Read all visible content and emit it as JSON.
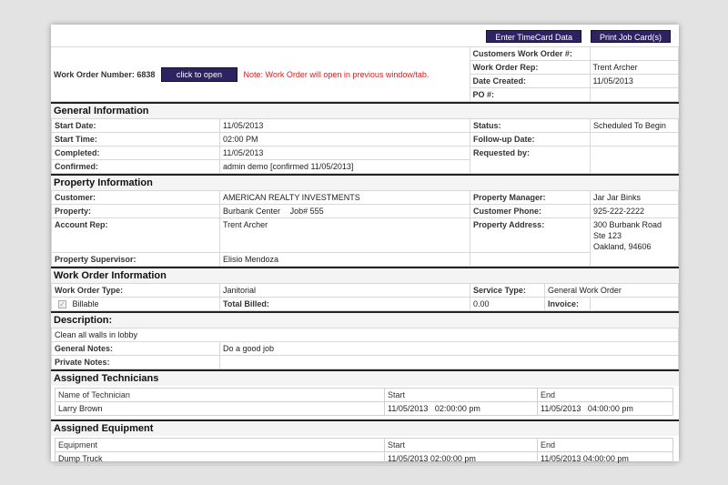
{
  "toolbar": {
    "timecard_label": "Enter TimeCard Data",
    "print_label": "Print Job Card(s)"
  },
  "work_order": {
    "number_label": "Work Order Number:",
    "number": "6838",
    "open_label": "click to open",
    "note": "Note: Work Order will open in previous window/tab.",
    "customers_wo_label": "Customers Work Order #:",
    "customers_wo_value": "",
    "rep_label": "Work Order Rep:",
    "rep_value": "Trent Archer",
    "created_label": "Date Created:",
    "created_value": "11/05/2013",
    "po_label": "PO #:",
    "po_value": ""
  },
  "general": {
    "title": "General Information",
    "start_date_label": "Start Date:",
    "start_date": "11/05/2013",
    "start_time_label": "Start Time:",
    "start_time": "02:00 PM",
    "completed_label": "Completed:",
    "completed": "11/05/2013",
    "confirmed_label": "Confirmed:",
    "confirmed": "admin demo [confirmed 11/05/2013]",
    "status_label": "Status:",
    "status": "Scheduled To Begin",
    "followup_label": "Follow-up Date:",
    "followup": "",
    "requested_label": "Requested by:",
    "requested": ""
  },
  "property": {
    "title": "Property Information",
    "customer_label": "Customer:",
    "customer": "AMERICAN REALTY INVESTMENTS",
    "property_label": "Property:",
    "property": "Burbank Center",
    "job": "Job# 555",
    "rep_label": "Account Rep:",
    "rep": "Trent Archer",
    "supervisor_label": "Property Supervisor:",
    "supervisor": "Elisio Mendoza",
    "manager_label": "Property Manager:",
    "manager": "Jar Jar Binks",
    "phone_label": "Customer Phone:",
    "phone": "925-222-2222",
    "address_label": "Property Address:",
    "address_line1": "300 Burbank Road",
    "address_line2": "Ste 123",
    "address_line3": "Oakland, 94606"
  },
  "wo_info": {
    "title": "Work Order Information",
    "type_label": "Work Order Type:",
    "type": "Janitorial",
    "service_label": "Service Type:",
    "service": "General Work Order",
    "billable_label": "Billable",
    "total_label": "Total Billed:",
    "total": "0.00",
    "invoice_label": "Invoice:",
    "invoice": ""
  },
  "description": {
    "title": "Description:",
    "text": "Clean all walls in lobby",
    "general_notes_label": "General Notes:",
    "general_notes": "Do a good job",
    "private_notes_label": "Private Notes:",
    "private_notes": ""
  },
  "technicians": {
    "title": "Assigned Technicians",
    "headers": [
      "Name of Technician",
      "Start",
      "End"
    ],
    "rows": [
      [
        "Larry Brown",
        "11/05/2013   02:00:00 pm",
        "11/05/2013   04:00:00 pm"
      ]
    ]
  },
  "equipment": {
    "title": "Assigned Equipment",
    "headers": [
      "Equipment",
      "Start",
      "End"
    ],
    "rows": [
      [
        "Dump Truck",
        "11/05/2013 02:00:00 pm",
        "11/05/2013 04:00:00 pm"
      ]
    ]
  },
  "colors": {
    "button_bg": "#2e2360",
    "note_red": "#d42020",
    "background": "#e3e3e3"
  }
}
